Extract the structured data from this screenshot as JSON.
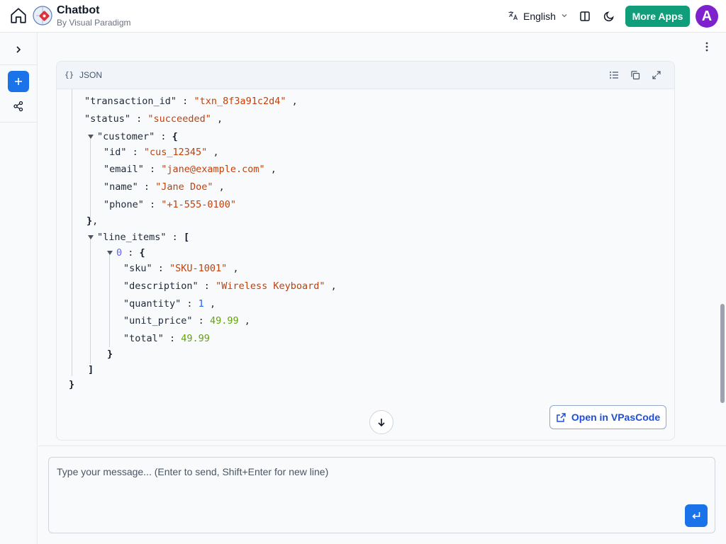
{
  "header": {
    "title": "Chatbot",
    "subtitle": "By Visual Paradigm",
    "language": "English",
    "more_apps_label": "More Apps",
    "avatar_initial": "A"
  },
  "colors": {
    "accent": "#1a73e8",
    "more_apps": "#0f9d7a",
    "avatar": "#7e22ce",
    "json_string": "#c2410c",
    "json_number": "#65a30d"
  },
  "json_block": {
    "label": "JSON",
    "braces": "{}",
    "lines": {
      "transaction_id_key": "\"transaction_id\"",
      "transaction_id_val": "\"txn_8f3a91c2d4\"",
      "status_key": "\"status\"",
      "status_val": "\"succeeded\"",
      "customer_key": "\"customer\"",
      "id_key": "\"id\"",
      "id_val": "\"cus_12345\"",
      "email_key": "\"email\"",
      "email_val": "\"jane@example.com\"",
      "name_key": "\"name\"",
      "name_val": "\"Jane Doe\"",
      "phone_key": "\"phone\"",
      "phone_val": "\"+1-555-0100\"",
      "line_items_key": "\"line_items\"",
      "index_0": "0",
      "sku_key": "\"sku\"",
      "sku_val": "\"SKU-1001\"",
      "description_key": "\"description\"",
      "description_val": "\"Wireless Keyboard\"",
      "quantity_key": "\"quantity\"",
      "quantity_val": "1",
      "unit_price_key": "\"unit_price\"",
      "unit_price_val": "49.99",
      "total_key": "\"total\"",
      "total_val": "49.99"
    },
    "open_button_label": "Open in VPasCode"
  },
  "composer": {
    "placeholder": "Type your message... (Enter to send, Shift+Enter for new line)"
  }
}
